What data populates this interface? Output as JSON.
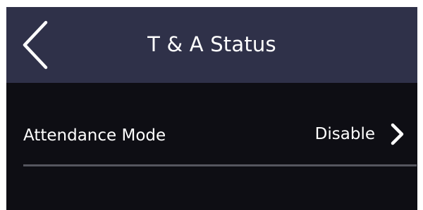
{
  "header": {
    "title": "T & A Status",
    "back_icon": "chevron-left-icon"
  },
  "settings": {
    "attendance_mode": {
      "label": "Attendance Mode",
      "value": "Disable",
      "icon": "chevron-right-icon"
    }
  },
  "colors": {
    "header_background": "#2f3149",
    "screen_background": "#0e0e14",
    "text": "#ffffff",
    "divider": "#55565f"
  }
}
